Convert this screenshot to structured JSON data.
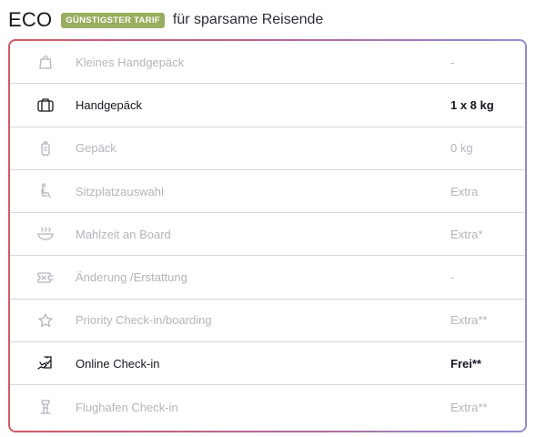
{
  "header": {
    "title": "ECO",
    "badge": "GÜNSTIGSTER TARIF",
    "subtitle": "für sparsame Reisende"
  },
  "rows": [
    {
      "icon": "small-bag-icon",
      "label": "Kleines Handgepäck",
      "value": "-",
      "active": false
    },
    {
      "icon": "briefcase-icon",
      "label": "Handgepäck",
      "value": "1 x 8 kg",
      "active": true
    },
    {
      "icon": "luggage-icon",
      "label": "Gepäck",
      "value": "0 kg",
      "active": false
    },
    {
      "icon": "seat-icon",
      "label": "Sitzplatzauswahl",
      "value": "Extra",
      "active": false
    },
    {
      "icon": "meal-icon",
      "label": "Mahlzeit an Board",
      "value": "Extra*",
      "active": false
    },
    {
      "icon": "ticket-change-icon",
      "label": "Änderung /Erstattung",
      "value": "-",
      "active": false
    },
    {
      "icon": "star-icon",
      "label": "Priority Check-in/boarding",
      "value": "Extra**",
      "active": false
    },
    {
      "icon": "mobile-checkin-icon",
      "label": "Online Check-in",
      "value": "Frei**",
      "active": true
    },
    {
      "icon": "airport-tower-icon",
      "label": "Flughafen Check-in",
      "value": "Extra**",
      "active": false
    }
  ],
  "colors": {
    "badge_bg": "#9aae5f",
    "border_gradient_start": "#d35a68",
    "border_gradient_end": "#8f8ed2",
    "inactive_text": "#b3b5bb",
    "active_text": "#15171f"
  }
}
